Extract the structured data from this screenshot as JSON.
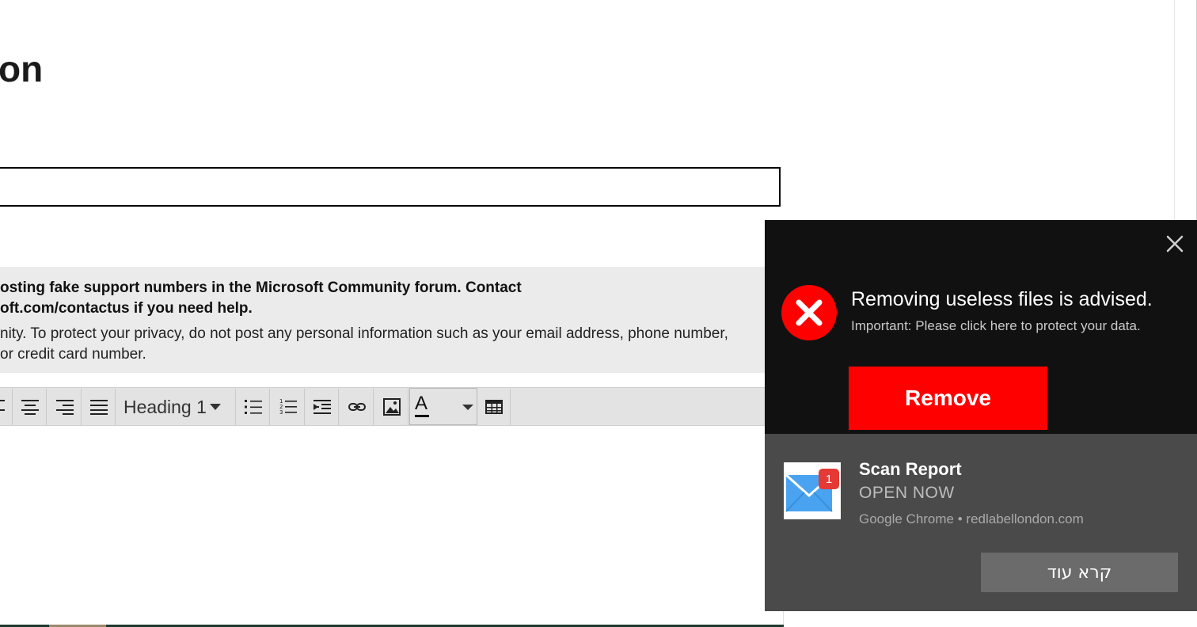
{
  "page": {
    "title": "on"
  },
  "notice": {
    "bold_line_1": "osting fake support numbers in the Microsoft Community forum. Contact",
    "bold_line_2": "oft.com/contactus if you need help.",
    "text_line_1": "nity. To protect your privacy, do not post any personal information such as your email address, phone number,",
    "text_line_2": "or credit card number."
  },
  "toolbar": {
    "heading_value": "Heading 1",
    "font_color_letter": "A",
    "buttons": [
      "align-center",
      "align-right",
      "align-justify",
      "bulleted-list",
      "numbered-list",
      "indent",
      "link",
      "image",
      "font-color",
      "table"
    ]
  },
  "ad": {
    "headline": "Removing useless files is advised.",
    "subtext": "Important: Please click here to protect your data.",
    "button_label": "Remove",
    "accent_color": "#ff0000",
    "background_color": "#111111"
  },
  "notification": {
    "title": "Scan Report",
    "body": "OPEN NOW",
    "source": "Google Chrome • redlabellondon.com",
    "badge_count": "1",
    "action_label": "קרא עוד",
    "background_color": "#4a4a4a"
  }
}
